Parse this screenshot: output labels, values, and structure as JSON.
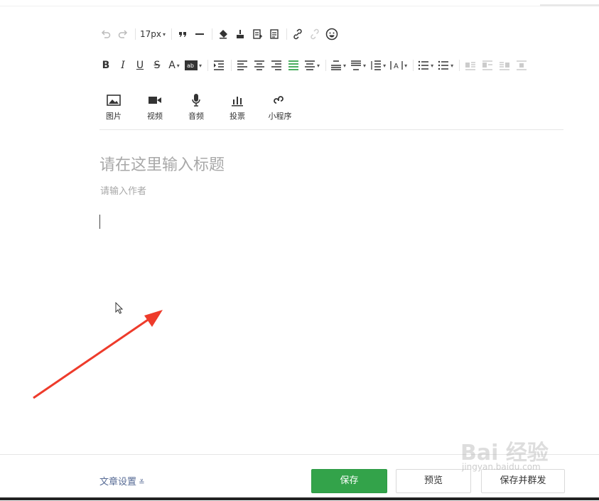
{
  "toolbar": {
    "font_size": "17px"
  },
  "media": {
    "image": "图片",
    "video": "视频",
    "audio": "音频",
    "vote": "投票",
    "mini_program": "小程序"
  },
  "editor": {
    "title_placeholder": "请在这里输入标题",
    "author_placeholder": "请输入作者"
  },
  "footer": {
    "settings_link": "文章设置",
    "save": "保存",
    "preview": "预览",
    "save_and_publish": "保存并群发"
  },
  "watermark": {
    "brand": "Bai  经验",
    "url": "jingyan.baidu.com"
  },
  "colors": {
    "save_button": "#33a34a",
    "link": "#576b95",
    "arrow": "#ee3b2b",
    "active_align": "#33a34a"
  }
}
